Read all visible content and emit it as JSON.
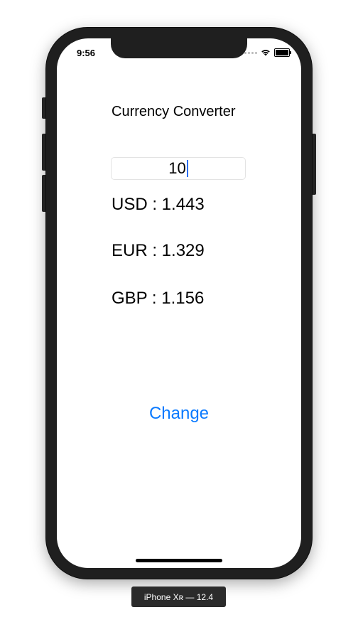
{
  "status_bar": {
    "time": "9:56",
    "icons": [
      "cellular-signal-icon",
      "wifi-icon",
      "battery-icon"
    ]
  },
  "app": {
    "title": "Currency Converter",
    "amount_input": {
      "value": "10",
      "placeholder": ""
    },
    "rates": [
      {
        "label": "USD : 1.443"
      },
      {
        "label": "EUR : 1.329"
      },
      {
        "label": "GBP : 1.156"
      }
    ],
    "change_button": "Change"
  },
  "device": {
    "label": "iPhone Xʀ — 12.4"
  },
  "colors": {
    "accent": "#0a7aff",
    "caret": "#2a6ef2",
    "bezel": "#1f1f1f"
  }
}
